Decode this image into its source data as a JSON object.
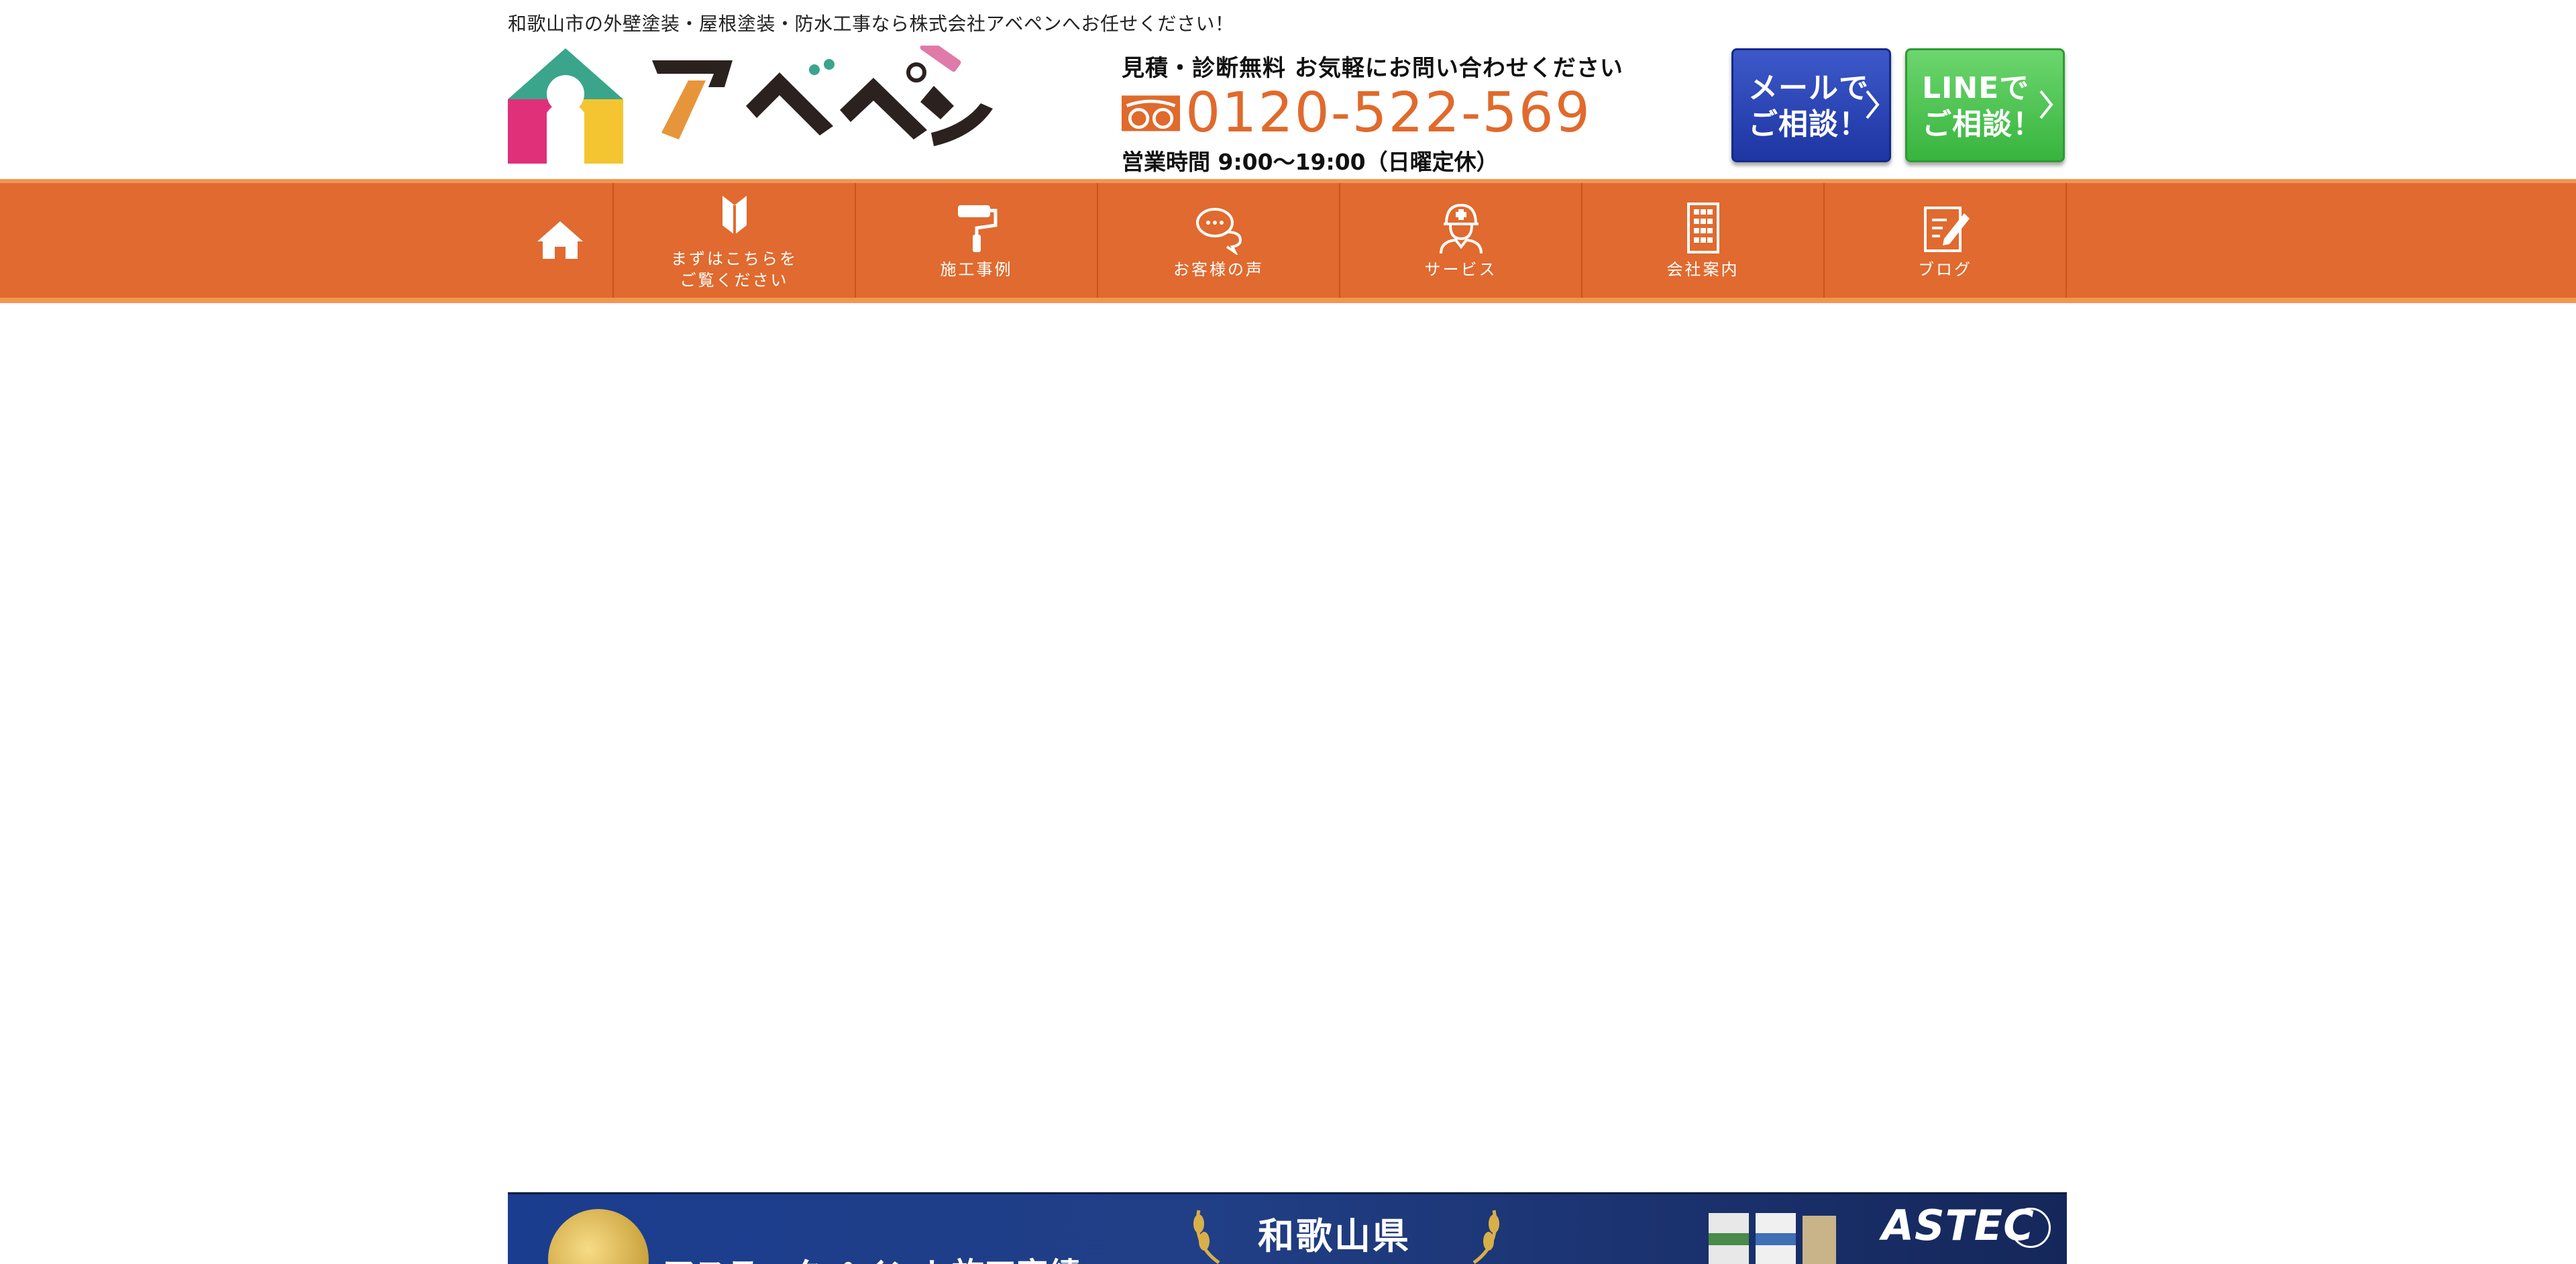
{
  "header": {
    "tagline": "和歌山市の外壁塗装・屋根塗装・防水工事なら株式会社アベペンへお任せください！",
    "logo_text": "アベペン",
    "contact_lead": "見積・診断無料 お気軽にお問い合わせください",
    "phone": "0120-522-569",
    "hours": "営業時間 9:00〜19:00（日曜定休）",
    "cta_mail_line1": "メールで",
    "cta_mail_line2": "ご相談！",
    "cta_line_line1": "LINEで",
    "cta_line_line2": "ご相談！"
  },
  "nav": {
    "items": [
      {
        "label": "",
        "icon": "home-icon"
      },
      {
        "label": "まずはこちらを\nご覧ください",
        "icon": "beginner-mark-icon"
      },
      {
        "label": "施工事例",
        "icon": "paint-roller-icon"
      },
      {
        "label": "お客様の声",
        "icon": "speech-bubbles-icon"
      },
      {
        "label": "サービス",
        "icon": "worker-icon"
      },
      {
        "label": "会社案内",
        "icon": "building-icon"
      },
      {
        "label": "ブログ",
        "icon": "note-pen-icon"
      }
    ]
  },
  "banner": {
    "line1": "アステックペイント施工実績",
    "region": "和歌山県",
    "brand": "ASTEC"
  },
  "colors": {
    "accent": "#e06a2f",
    "phone": "#e06a2c",
    "mail_button": "#2a43b4",
    "line_button": "#4cc254"
  }
}
